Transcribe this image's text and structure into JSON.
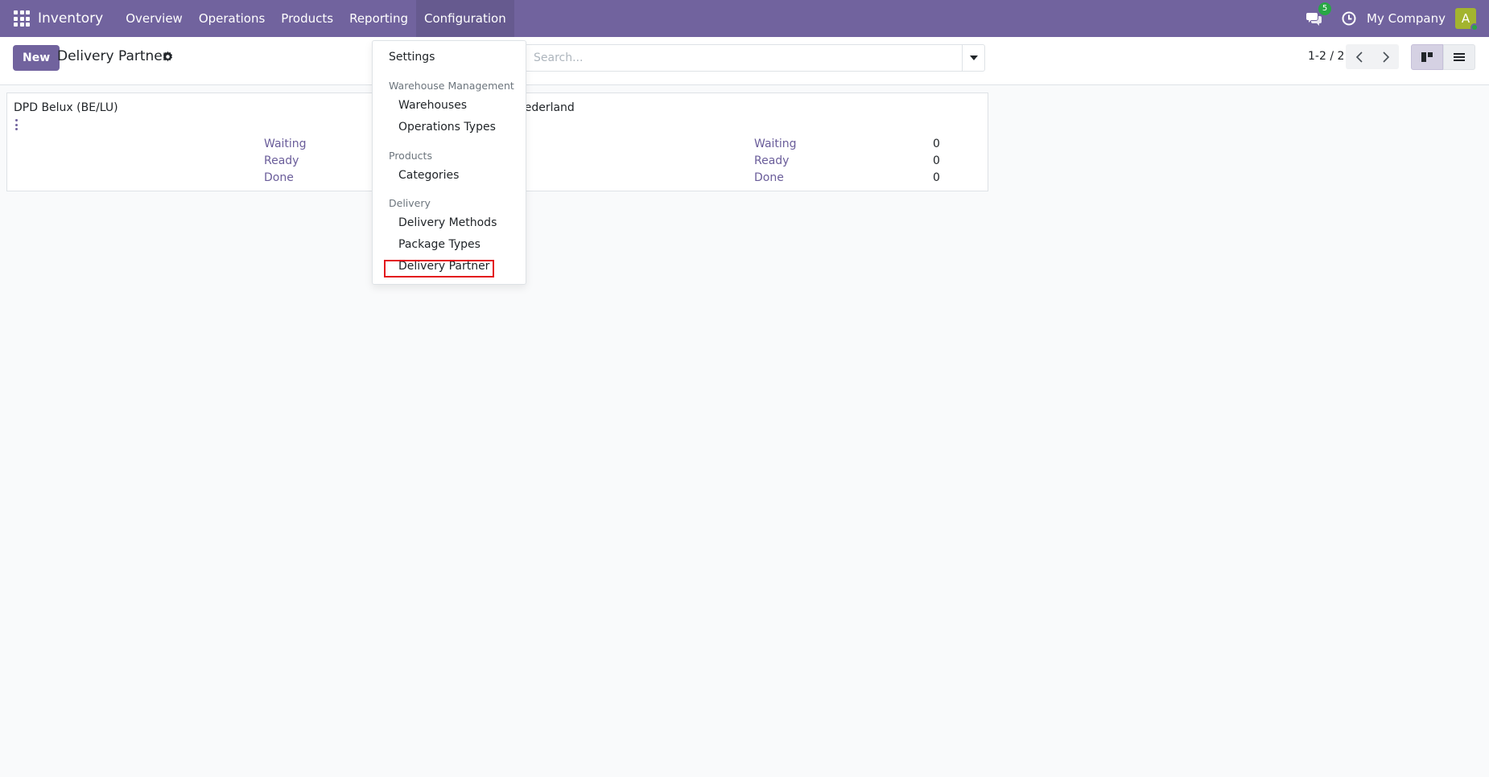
{
  "navbar": {
    "app_name": "Inventory",
    "menu": [
      "Overview",
      "Operations",
      "Products",
      "Reporting",
      "Configuration"
    ],
    "active_menu": "Configuration",
    "message_count": "5",
    "company": "My Company",
    "avatar_letter": "A",
    "colors": {
      "brand": "#71639e",
      "avatar": "#a3b42f",
      "badge": "#28a745"
    }
  },
  "control_panel": {
    "new_label": "New",
    "title": "Delivery Partner",
    "search_placeholder": "Search...",
    "pager": "1-2 / 2"
  },
  "cards": [
    {
      "name": "DPD Belux (BE/LU)",
      "stats": [
        {
          "label": "Waiting",
          "value": ""
        },
        {
          "label": "Ready",
          "value": ""
        },
        {
          "label": "Done",
          "value": ""
        }
      ]
    },
    {
      "name": "D Nederland",
      "stats": [
        {
          "label": "Waiting",
          "value": "0"
        },
        {
          "label": "Ready",
          "value": "0"
        },
        {
          "label": "Done",
          "value": "0"
        }
      ]
    }
  ],
  "dropdown": {
    "settings": "Settings",
    "warehouse_header": "Warehouse Management",
    "warehouses": "Warehouses",
    "operation_types": "Operations Types",
    "products_header": "Products",
    "categories": "Categories",
    "delivery_header": "Delivery",
    "delivery_methods": "Delivery Methods",
    "package_types": "Package Types",
    "delivery_partner": "Delivery Partner",
    "highlight_color": "#e3141c"
  }
}
